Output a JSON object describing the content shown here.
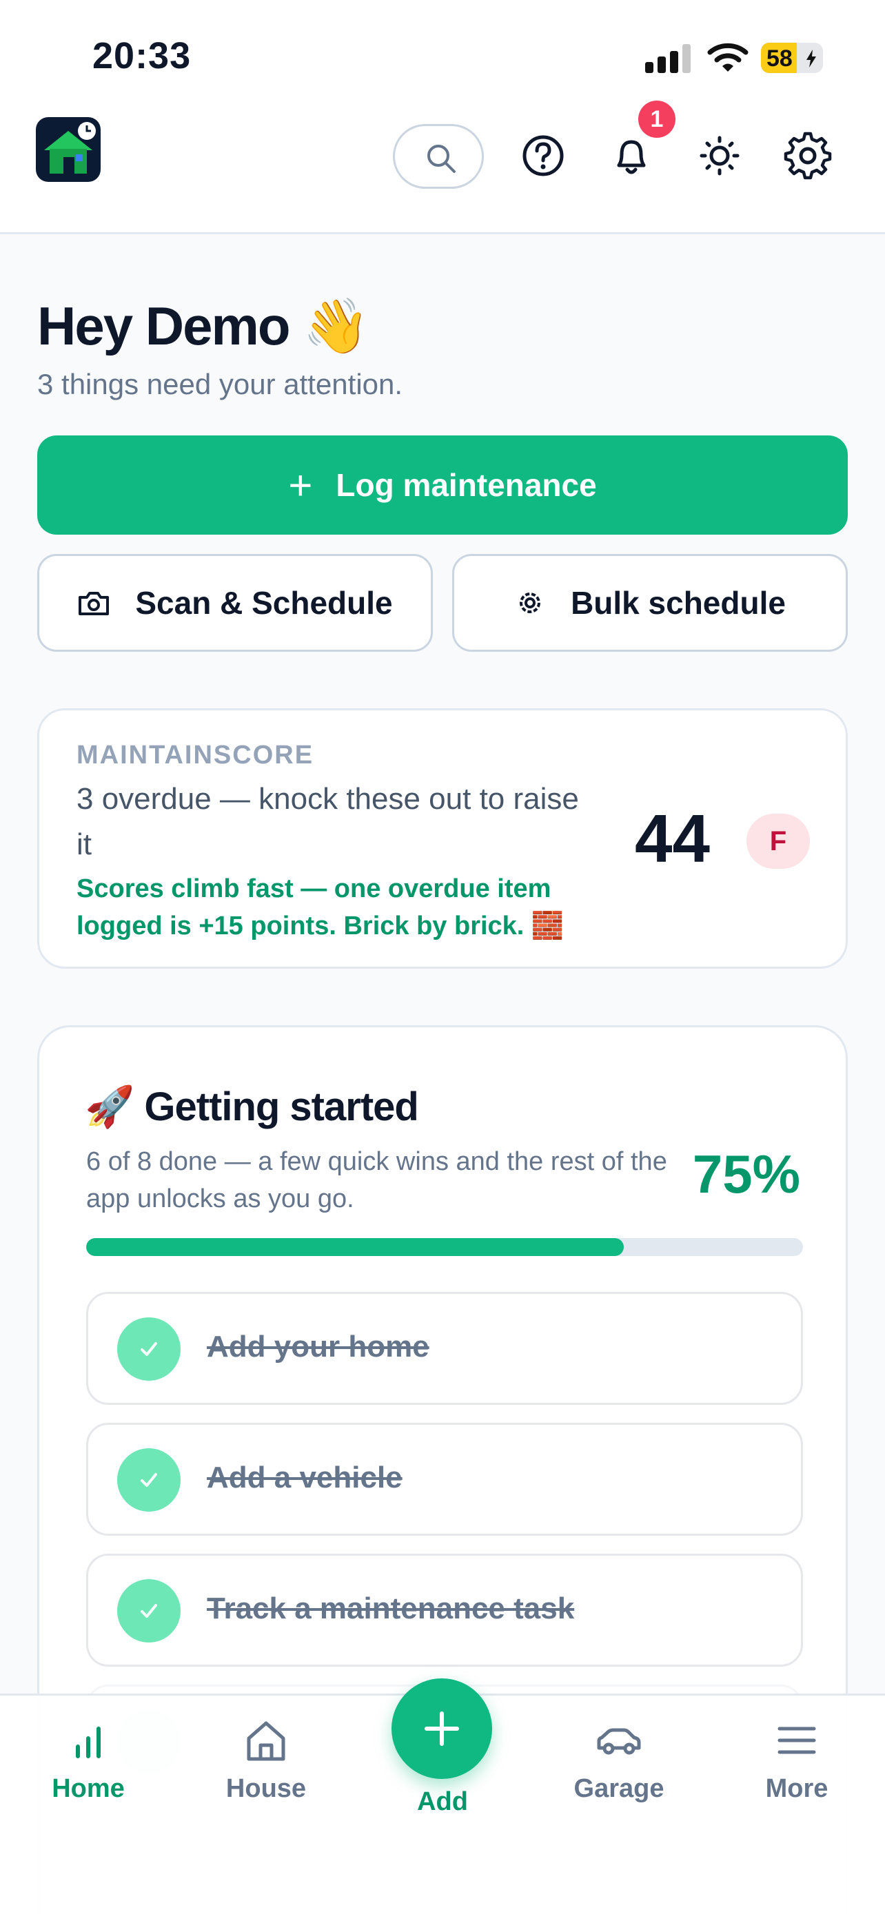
{
  "status_bar": {
    "time": "20:33",
    "battery": "58",
    "battery_level": 0.58,
    "icons": [
      "signal-icon",
      "wifi-icon",
      "battery-charging-icon"
    ]
  },
  "header": {
    "icons": [
      "app-logo-house-icon",
      "search-icon",
      "help-icon",
      "bell-icon",
      "sun-icon",
      "gear-icon"
    ],
    "notification_count": "1"
  },
  "greeting": {
    "title": "Hey Demo 👋",
    "subtitle": "3 things need your attention."
  },
  "actions": {
    "log_label": "Log maintenance",
    "scan_label": "Scan & Schedule",
    "bulk_label": "Bulk schedule"
  },
  "score": {
    "eyebrow": "MAINTAINSCORE",
    "status": "3 overdue — knock these out to raise it",
    "tip": "Scores climb fast — one overdue item logged is +15 points. Brick by brick. 🧱",
    "value": "44",
    "grade": "F"
  },
  "getting_started": {
    "title": "🚀 Getting started",
    "subtitle": "6 of 8 done — a few quick wins and the rest of the app unlocks as you go.",
    "percent": "75%",
    "progress": 0.75,
    "tasks": [
      {
        "label": "Add your home",
        "done": true
      },
      {
        "label": "Add a vehicle",
        "done": true
      },
      {
        "label": "Track a maintenance task",
        "done": true
      }
    ]
  },
  "nav": {
    "items": [
      {
        "label": "Home",
        "icon": "chart-bars-icon",
        "active": true
      },
      {
        "label": "House",
        "icon": "house-icon",
        "active": false
      },
      {
        "label": "Add",
        "icon": "plus-icon",
        "active": false
      },
      {
        "label": "Garage",
        "icon": "car-icon",
        "active": false
      },
      {
        "label": "More",
        "icon": "menu-icon",
        "active": false
      }
    ]
  },
  "colors": {
    "accent": "#10b981",
    "accent_dark": "#059669",
    "danger": "#f43f5e",
    "text": "#0f172a",
    "muted": "#64748b"
  }
}
